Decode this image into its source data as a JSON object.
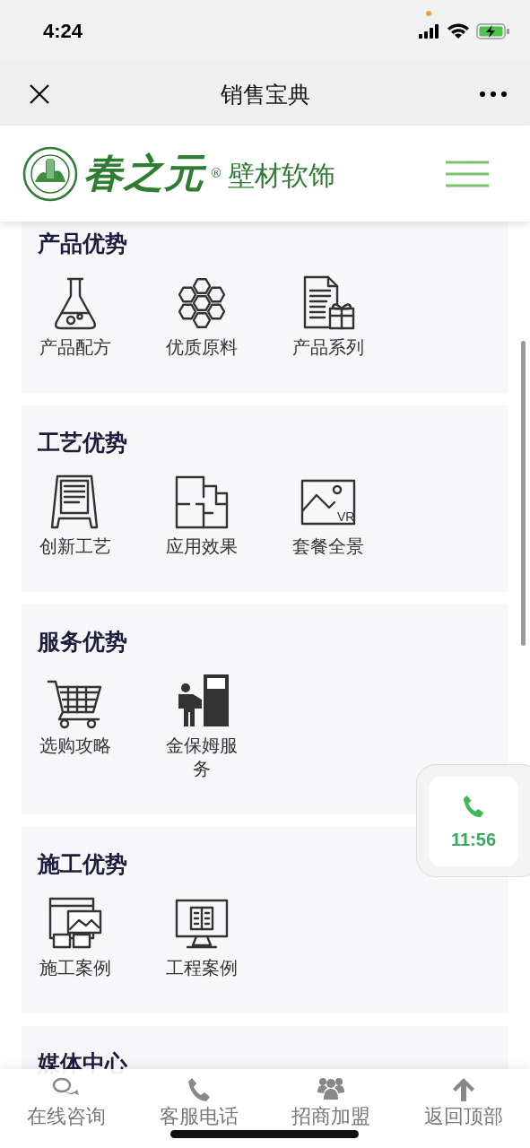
{
  "status_bar": {
    "time": "4:24"
  },
  "nav_bar": {
    "title": "销售宝典"
  },
  "header": {
    "brand": "春之元",
    "registered": "®",
    "tagline": "壁材软饰"
  },
  "sections": [
    {
      "title": "产品优势",
      "items": [
        {
          "label": "产品配方"
        },
        {
          "label": "优质原料"
        },
        {
          "label": "产品系列"
        }
      ]
    },
    {
      "title": "工艺优势",
      "items": [
        {
          "label": "创新工艺"
        },
        {
          "label": "应用效果"
        },
        {
          "label": "套餐全景",
          "icon_text": "VR"
        }
      ]
    },
    {
      "title": "服务优势",
      "items": [
        {
          "label": "选购攻略"
        },
        {
          "label": "金保姆服务"
        }
      ]
    },
    {
      "title": "施工优势",
      "items": [
        {
          "label": "施工案例"
        },
        {
          "label": "工程案例"
        }
      ]
    },
    {
      "title": "媒体中心"
    }
  ],
  "call_widget": {
    "time": "11:56"
  },
  "tab_bar": [
    {
      "label": "在线咨询"
    },
    {
      "label": "客服电话"
    },
    {
      "label": "招商加盟"
    },
    {
      "label": "返回顶部"
    }
  ]
}
